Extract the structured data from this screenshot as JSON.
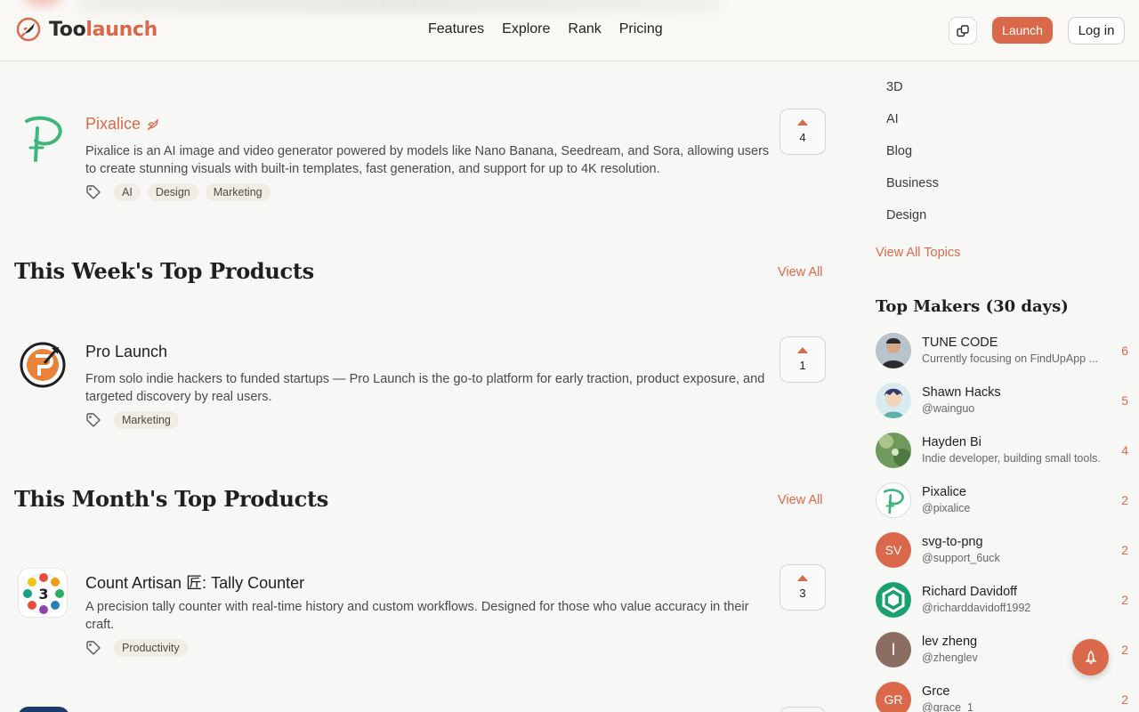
{
  "brand": {
    "name_part1": "Too",
    "name_part2": "launch",
    "accent": "#d9694a"
  },
  "nav": {
    "items": [
      "Features",
      "Explore",
      "Rank",
      "Pricing"
    ]
  },
  "header_actions": {
    "theme_icon": "share-box-icon",
    "launch_label": "Launch",
    "login_label": "Log in"
  },
  "featured_product": {
    "name": "Pixalice",
    "badge_icon": "rocket-icon",
    "description": "Pixalice is an AI image and video generator powered by models like Nano Banana, Seedream, and Sora, allowing users to create stunning visuals with built-in templates, fast generation, and support for up to 4K resolution.",
    "tags": [
      "AI",
      "Design",
      "Marketing"
    ],
    "votes": "4"
  },
  "weekly": {
    "title": "This Week's Top Products",
    "view_all": "View All",
    "product": {
      "name": "Pro Launch",
      "description": "From solo indie hackers to funded startups — Pro Launch is the go-to platform for early traction, product exposure, and targeted discovery by real users.",
      "tags": [
        "Marketing"
      ],
      "votes": "1"
    }
  },
  "monthly": {
    "title": "This Month's Top Products",
    "view_all": "View All",
    "product": {
      "name": "Count Artisan 匠: Tally Counter",
      "description": "A precision tally counter with real-time history and custom workflows. Designed for those who value accuracy in their craft.",
      "tags": [
        "Productivity"
      ],
      "votes": "3"
    }
  },
  "sidebar": {
    "topics": [
      "3D",
      "AI",
      "Blog",
      "Business",
      "Design"
    ],
    "view_all_topics": "View All Topics",
    "makers_title": "Top Makers (30 days)",
    "makers": [
      {
        "name": "TUNE CODE",
        "sub": "Currently focusing on FindUpApp ...",
        "count": "6",
        "avatar": "photo"
      },
      {
        "name": "Shawn Hacks",
        "sub": "@wainguo",
        "count": "5",
        "avatar": "illustration"
      },
      {
        "name": "Hayden Bi",
        "sub": "Indie developer, building small tools.",
        "count": "4",
        "avatar": "nature"
      },
      {
        "name": "Pixalice",
        "sub": "@pixalice",
        "count": "2",
        "avatar": "logo"
      },
      {
        "name": "svg-to-png",
        "sub": "@support_6uck",
        "count": "2",
        "avatar": "SV"
      },
      {
        "name": "Richard Davidoff",
        "sub": "@richarddavidoff1992",
        "count": "2",
        "avatar": "hex"
      },
      {
        "name": "lev zheng",
        "sub": "@zhenglev",
        "count": "2",
        "avatar": "l"
      },
      {
        "name": "Grce",
        "sub": "@grace_1",
        "count": "2",
        "avatar": "GR"
      }
    ]
  },
  "fab_icon": "rocket-icon"
}
